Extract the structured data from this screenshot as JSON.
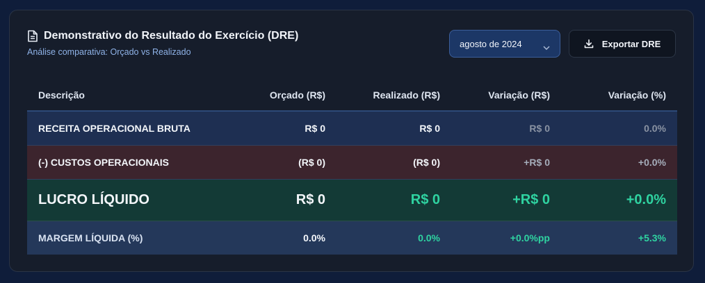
{
  "header": {
    "icon": "document-icon",
    "title": "Demonstrativo do Resultado do Exercício (DRE)",
    "subtitle": "Análise comparativa: Orçado vs Realizado"
  },
  "controls": {
    "period_value": "agosto de 2024",
    "export_label": "Exportar DRE"
  },
  "table": {
    "columns": [
      "Descrição",
      "Orçado (R$)",
      "Realizado (R$)",
      "Variação (R$)",
      "Variação (%)"
    ],
    "rows": [
      {
        "descricao": "RECEITA OPERACIONAL BRUTA",
        "orcado": "R$ 0",
        "realizado": "R$ 0",
        "variacao_rs": "R$ 0",
        "variacao_pct": "0.0%"
      },
      {
        "descricao": "(-) CUSTOS OPERACIONAIS",
        "orcado": "(R$ 0)",
        "realizado": "(R$ 0)",
        "variacao_rs": "+R$ 0",
        "variacao_pct": "+0.0%"
      },
      {
        "descricao": "LUCRO LÍQUIDO",
        "orcado": "R$ 0",
        "realizado": "R$ 0",
        "variacao_rs": "+R$ 0",
        "variacao_pct": "+0.0%"
      },
      {
        "descricao": "MARGEM LÍQUIDA (%)",
        "orcado": "0.0%",
        "realizado": "0.0%",
        "variacao_rs": "+0.0%pp",
        "variacao_pct": "+5.3%"
      }
    ]
  },
  "colors": {
    "accent_green": "#2fd3a1",
    "revenue_row": "#1e2f52",
    "cost_row": "#3c242d",
    "profit_row": "#133a36",
    "margin_row": "#24385a"
  }
}
